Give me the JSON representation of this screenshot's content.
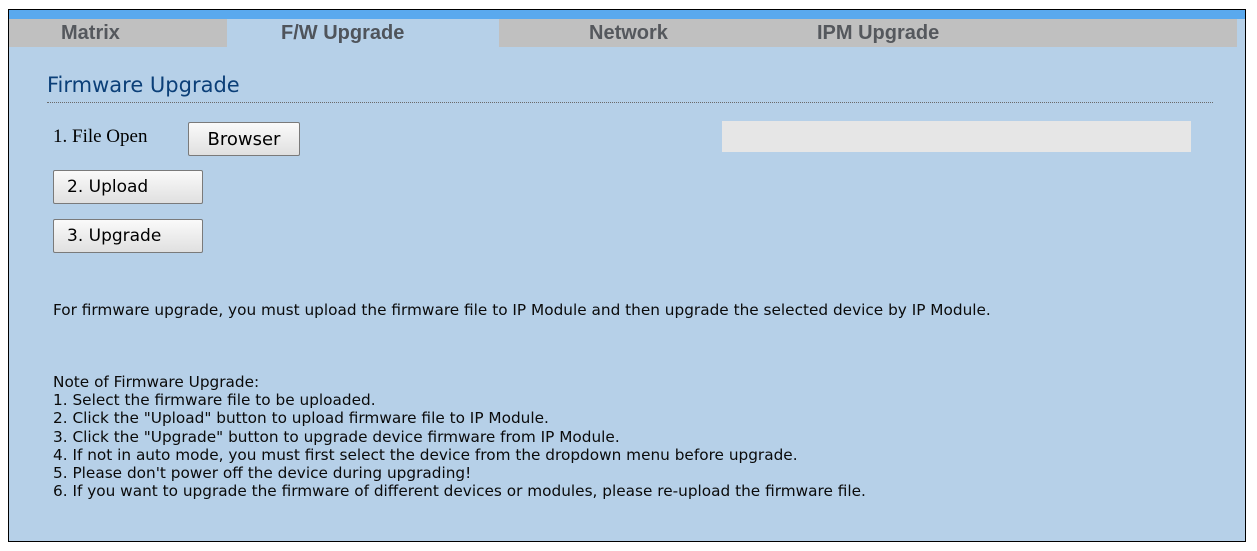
{
  "tabs": [
    {
      "label": "Matrix"
    },
    {
      "label": "F/W Upgrade"
    },
    {
      "label": "Network"
    },
    {
      "label": "IPM Upgrade"
    }
  ],
  "active_tab": "F/W Upgrade",
  "colors": {
    "top_strip": "#5aa9ee",
    "panel_bg": "#b6d0e8",
    "inactive_tab": "#c0c0c0",
    "title": "#0b3f78"
  },
  "section": {
    "title": "Firmware Upgrade"
  },
  "file_open": {
    "label": "1. File Open",
    "browse_button": "Browser",
    "path_value": ""
  },
  "buttons": {
    "upload": "2. Upload",
    "upgrade": "3. Upgrade"
  },
  "description": "For firmware upgrade, you must upload the firmware file to IP Module and then upgrade the selected device by IP Module.",
  "notes": {
    "heading": "Note of Firmware Upgrade:",
    "items": [
      "1. Select the firmware file to be uploaded.",
      "2. Click the \"Upload\" button to upload firmware file to IP Module.",
      "3. Click the \"Upgrade\" button to upgrade device firmware from IP Module.",
      "4. If not in auto mode, you must first select the device from the dropdown menu before upgrade.",
      "5. Please don't power off the device during upgrading!",
      "6. If you want to upgrade the firmware of different devices or modules, please re-upload the firmware file."
    ]
  }
}
